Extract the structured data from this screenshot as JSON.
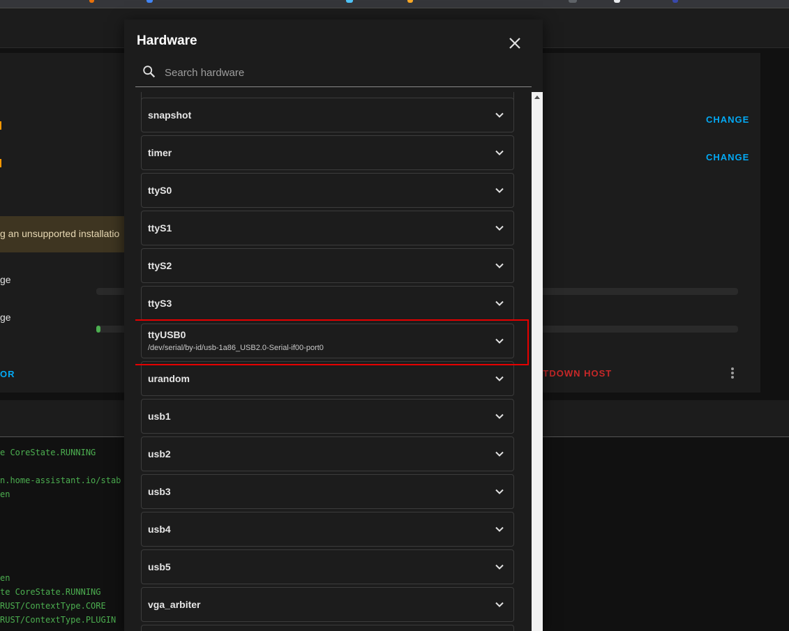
{
  "background": {
    "change_buttons": [
      "CHANGE",
      "CHANGE"
    ],
    "warning_text": "g an unsupported installatio",
    "usage_labels": [
      "ge",
      "ge"
    ],
    "left_link": "OR",
    "shutdown_label": "UTDOWN HOST",
    "log_lines": [
      "e CoreState.RUNNING",
      "n.home-assistant.io/stab",
      "en",
      "en",
      "te CoreState.RUNNING",
      "RUST/ContextType.CORE",
      "RUST/ContextType.PLUGIN"
    ]
  },
  "dialog": {
    "title": "Hardware",
    "search_placeholder": "Search hardware",
    "items": [
      {
        "name": "snapshot"
      },
      {
        "name": "timer"
      },
      {
        "name": "ttyS0"
      },
      {
        "name": "ttyS1"
      },
      {
        "name": "ttyS2"
      },
      {
        "name": "ttyS3"
      },
      {
        "name": "ttyUSB0",
        "path": "/dev/serial/by-id/usb-1a86_USB2.0-Serial-if00-port0"
      },
      {
        "name": "urandom"
      },
      {
        "name": "usb1"
      },
      {
        "name": "usb2"
      },
      {
        "name": "usb3"
      },
      {
        "name": "usb4"
      },
      {
        "name": "usb5"
      },
      {
        "name": "vga_arbiter"
      }
    ]
  },
  "colors": {
    "accent": "#03a9f4",
    "danger": "#c62828",
    "highlight_box": "#e60000",
    "log_text": "#4caf50"
  },
  "icons": [
    "search-icon",
    "close-icon",
    "chevron-down-icon",
    "dots-vertical-icon"
  ]
}
